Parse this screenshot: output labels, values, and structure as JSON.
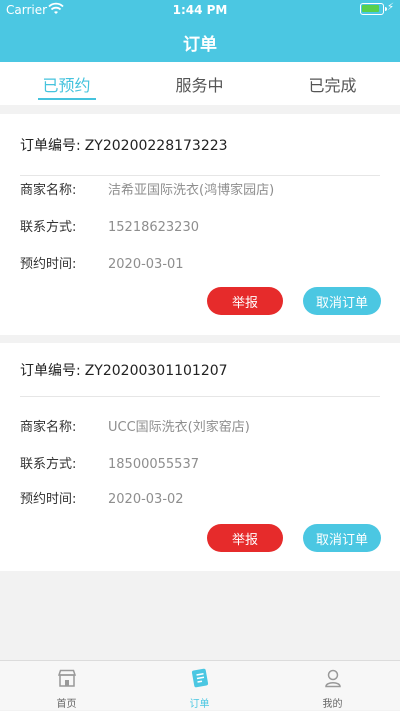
{
  "status_bar": {
    "carrier": "Carrier",
    "time": "1:44 PM"
  },
  "header": {
    "title": "订单"
  },
  "tabs": [
    {
      "label": "已预约",
      "active": true
    },
    {
      "label": "服务中",
      "active": false
    },
    {
      "label": "已完成",
      "active": false
    }
  ],
  "labels": {
    "order_no": "订单编号:",
    "merchant": "商家名称:",
    "contact": "联系方式:",
    "appointment": "预约时间:",
    "report": "举报",
    "cancel": "取消订单"
  },
  "orders": [
    {
      "order_no": "ZY20200228173223",
      "merchant": "洁希亚国际洗衣(鸿博家园店)",
      "contact": "15218623230",
      "appointment": "2020-03-01"
    },
    {
      "order_no": "ZY20200301101207",
      "merchant": "UCC国际洗衣(刘家窑店)",
      "contact": "18500055537",
      "appointment": "2020-03-02"
    }
  ],
  "tabbar": [
    {
      "label": "首页",
      "icon": "store-icon"
    },
    {
      "label": "订单",
      "icon": "order-icon",
      "active": true
    },
    {
      "label": "我的",
      "icon": "profile-icon"
    }
  ],
  "colors": {
    "accent": "#4bc7e2",
    "report": "#e62b2b"
  }
}
